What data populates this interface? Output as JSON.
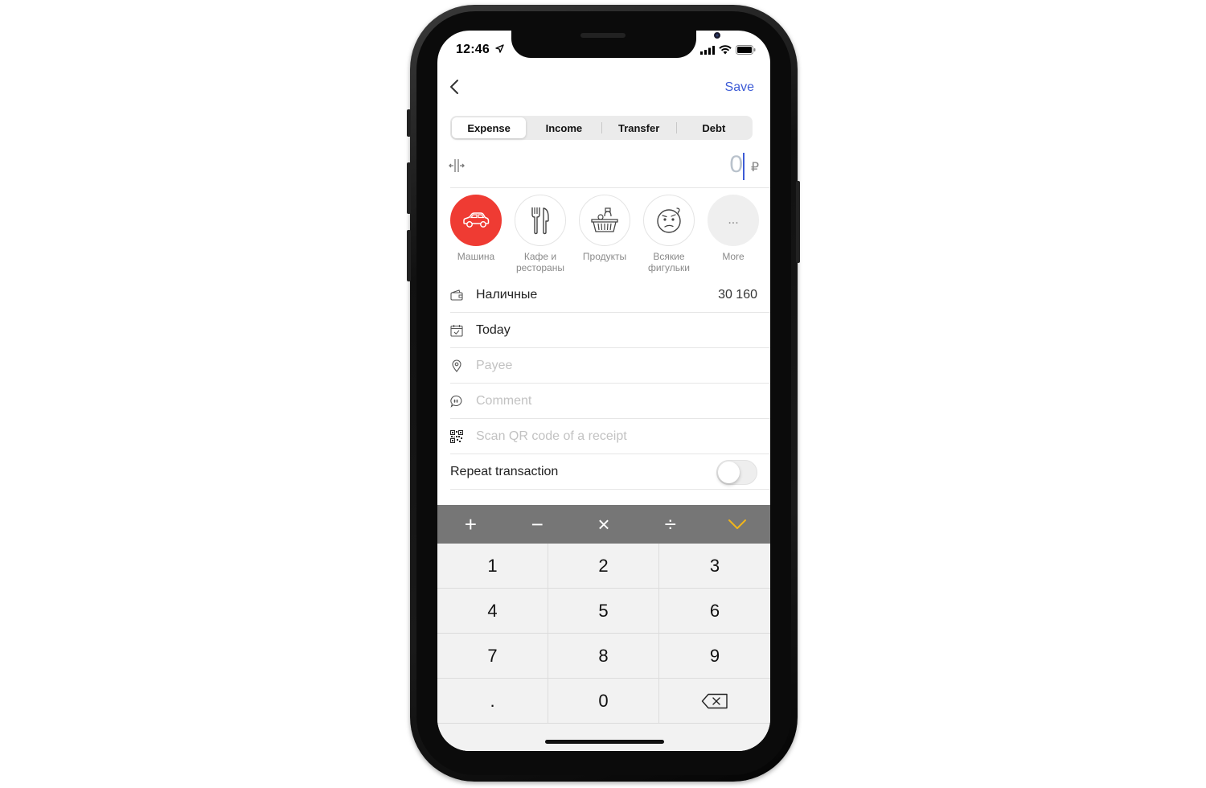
{
  "status_bar": {
    "time": "12:46"
  },
  "nav": {
    "save_label": "Save"
  },
  "tabs": [
    {
      "label": "Expense",
      "active": true
    },
    {
      "label": "Income",
      "active": false
    },
    {
      "label": "Transfer",
      "active": false
    },
    {
      "label": "Debt",
      "active": false
    }
  ],
  "amount": {
    "value": "0",
    "currency": "₽"
  },
  "categories": [
    {
      "label": "Машина",
      "icon": "car-icon",
      "active": true
    },
    {
      "label": "Кафе и\nрестораны",
      "icon": "fork-knife-icon",
      "active": false
    },
    {
      "label": "Продукты",
      "icon": "grocery-basket-icon",
      "active": false
    },
    {
      "label": "Всякие\nфигульки",
      "icon": "confused-face-icon",
      "active": false
    },
    {
      "label": "More",
      "icon": "ellipsis-icon",
      "active": false,
      "glyph": "..."
    }
  ],
  "rows": {
    "account": {
      "label": "Наличные",
      "value": "30 160",
      "icon": "wallet-icon"
    },
    "date": {
      "label": "Today",
      "icon": "calendar-icon"
    },
    "payee": {
      "placeholder": "Payee",
      "icon": "location-pin-icon"
    },
    "comment": {
      "placeholder": "Comment",
      "icon": "comment-icon"
    },
    "qr": {
      "placeholder": "Scan QR code of a receipt",
      "icon": "qr-code-icon"
    },
    "repeat": {
      "label": "Repeat transaction",
      "enabled": false
    }
  },
  "operators": [
    "+",
    "−",
    "×",
    "÷"
  ],
  "keypad": [
    "1",
    "2",
    "3",
    "4",
    "5",
    "6",
    "7",
    "8",
    "9",
    ".",
    "0"
  ],
  "colors": {
    "accent": "#3d5bd6",
    "category_active": "#ef3b33",
    "done": "#f0b41b",
    "operator_bar": "#767676"
  }
}
